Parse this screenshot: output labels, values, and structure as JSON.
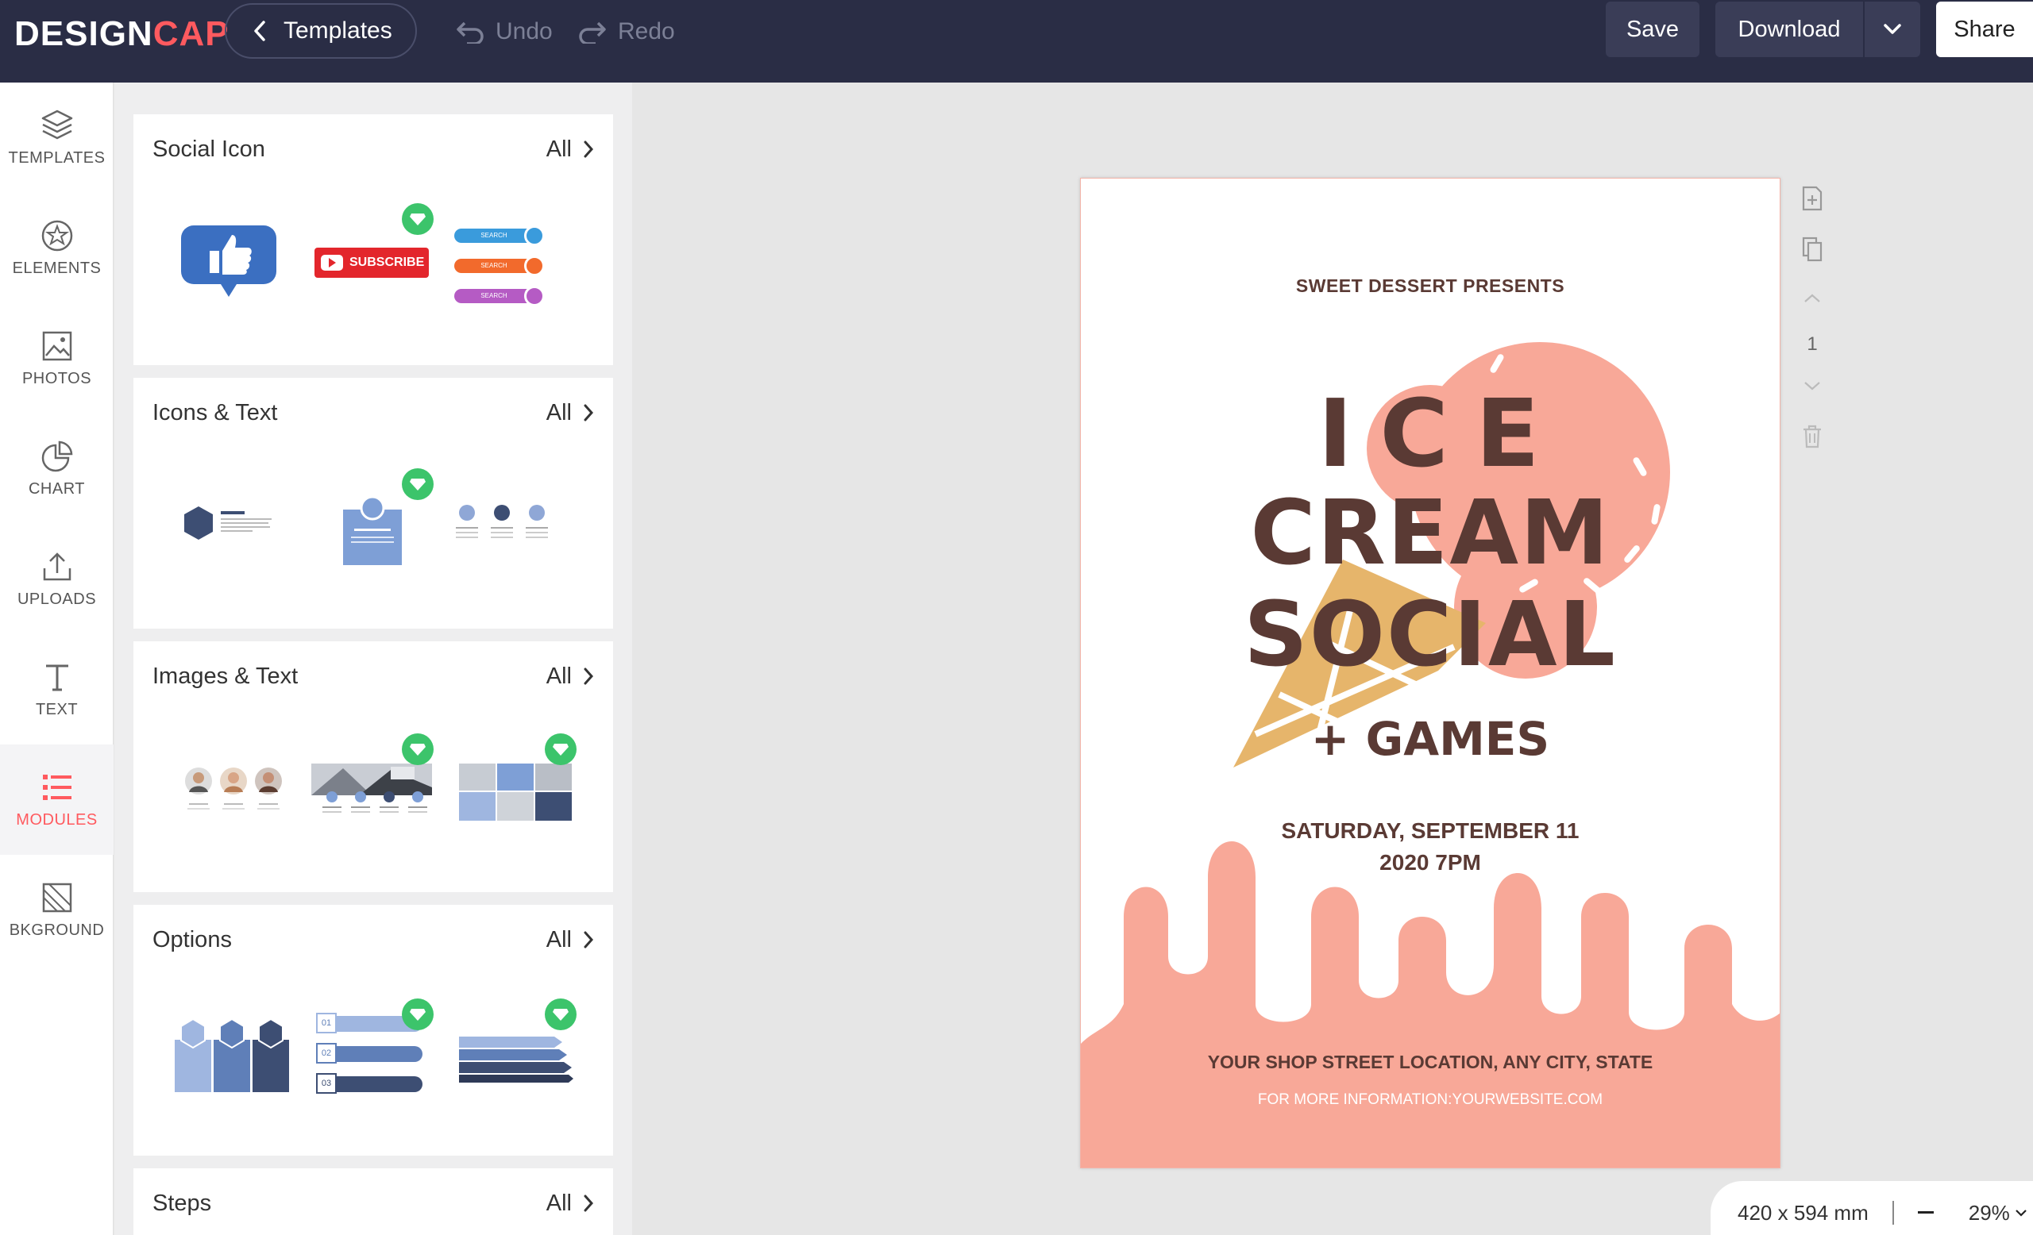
{
  "app": {
    "logo_main": "DESIGN",
    "logo_accent": "CAP"
  },
  "toolbar": {
    "templates_label": "Templates",
    "undo_label": "Undo",
    "redo_label": "Redo",
    "save_label": "Save",
    "download_label": "Download",
    "share_label": "Share"
  },
  "sidebar": {
    "items": [
      {
        "label": "TEMPLATES",
        "icon": "layers-icon"
      },
      {
        "label": "ELEMENTS",
        "icon": "shapes-icon"
      },
      {
        "label": "PHOTOS",
        "icon": "image-icon"
      },
      {
        "label": "CHART",
        "icon": "pie-chart-icon"
      },
      {
        "label": "UPLOADS",
        "icon": "upload-icon"
      },
      {
        "label": "TEXT",
        "icon": "text-icon"
      },
      {
        "label": "MODULES",
        "icon": "list-icon",
        "active": true
      },
      {
        "label": "BKGROUND",
        "icon": "background-icon"
      }
    ]
  },
  "modules": {
    "all_label": "All",
    "sections": [
      {
        "title": "Social Icon"
      },
      {
        "title": "Icons & Text"
      },
      {
        "title": "Images & Text"
      },
      {
        "title": "Options"
      },
      {
        "title": "Steps"
      }
    ],
    "social": {
      "subscribe": "SUBSCRIBE",
      "search": "SEARCH"
    },
    "options_numbers": [
      "01",
      "02",
      "03"
    ]
  },
  "poster": {
    "presents": "SWEET DESSERT PRESENTS",
    "ice": "ICE",
    "cream": "CREAM",
    "social": "SOCIAL",
    "games": "+ GAMES",
    "date_line1": "SATURDAY, SEPTEMBER 11",
    "date_line2": "2020 7PM",
    "address": "YOUR SHOP STREET LOCATION, ANY CITY, STATE",
    "website": "FOR MORE INFORMATION:YOURWEBSITE.COM"
  },
  "page_controls": {
    "page_number": "1"
  },
  "status": {
    "dimensions": "420 x 594 mm",
    "zoom": "29%"
  },
  "colors": {
    "topbar": "#2a2d45",
    "accent": "#ff5a5f",
    "poster_pink": "#f8a898",
    "poster_text": "#5a3a34",
    "cone": "#e6b56b",
    "premium_badge": "#3cc46b"
  }
}
